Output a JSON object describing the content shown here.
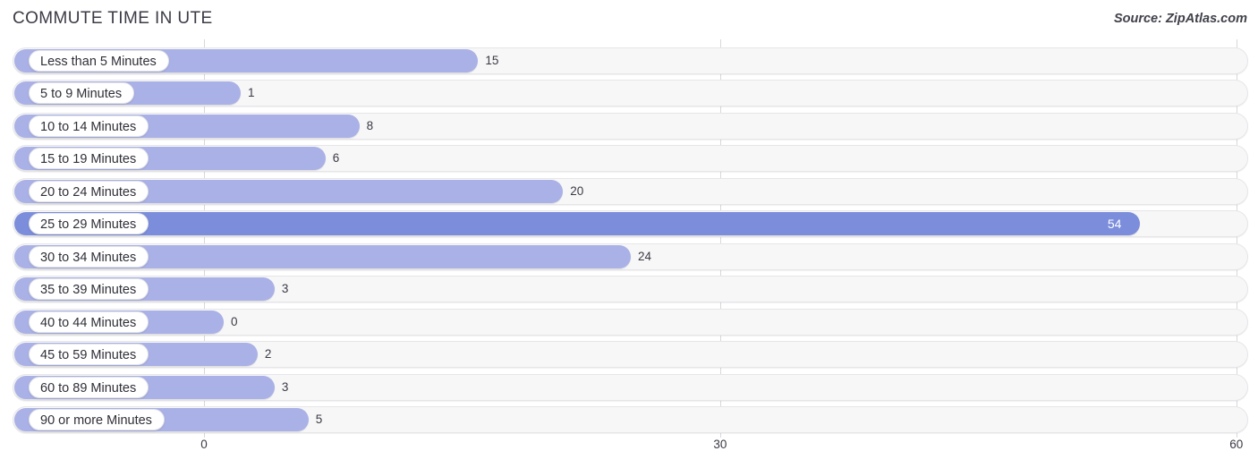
{
  "header": {
    "title": "COMMUTE TIME IN UTE",
    "source": "Source: ZipAtlas.com"
  },
  "colors": {
    "bar": "#a9b1e6",
    "bar_max": "#7b8ddb",
    "track": "#f7f7f8",
    "text": "#3a3a44",
    "gridline": "#d8d8dc"
  },
  "chart_data": {
    "type": "bar",
    "orientation": "horizontal",
    "title": "COMMUTE TIME IN UTE",
    "xlabel": "",
    "ylabel": "",
    "xlim": [
      0,
      60
    ],
    "xticks": [
      0,
      30,
      60
    ],
    "xtick_labels": [
      "0",
      "30",
      "60"
    ],
    "grid": true,
    "legend": false,
    "categories": [
      "Less than 5 Minutes",
      "5 to 9 Minutes",
      "10 to 14 Minutes",
      "15 to 19 Minutes",
      "20 to 24 Minutes",
      "25 to 29 Minutes",
      "30 to 34 Minutes",
      "35 to 39 Minutes",
      "40 to 44 Minutes",
      "45 to 59 Minutes",
      "60 to 89 Minutes",
      "90 or more Minutes"
    ],
    "values": [
      15,
      1,
      8,
      6,
      20,
      54,
      24,
      3,
      0,
      2,
      3,
      5
    ],
    "value_labels": [
      "15",
      "1",
      "8",
      "6",
      "20",
      "54",
      "24",
      "3",
      "0",
      "2",
      "3",
      "5"
    ],
    "max_value": 54,
    "max_index": 5
  }
}
